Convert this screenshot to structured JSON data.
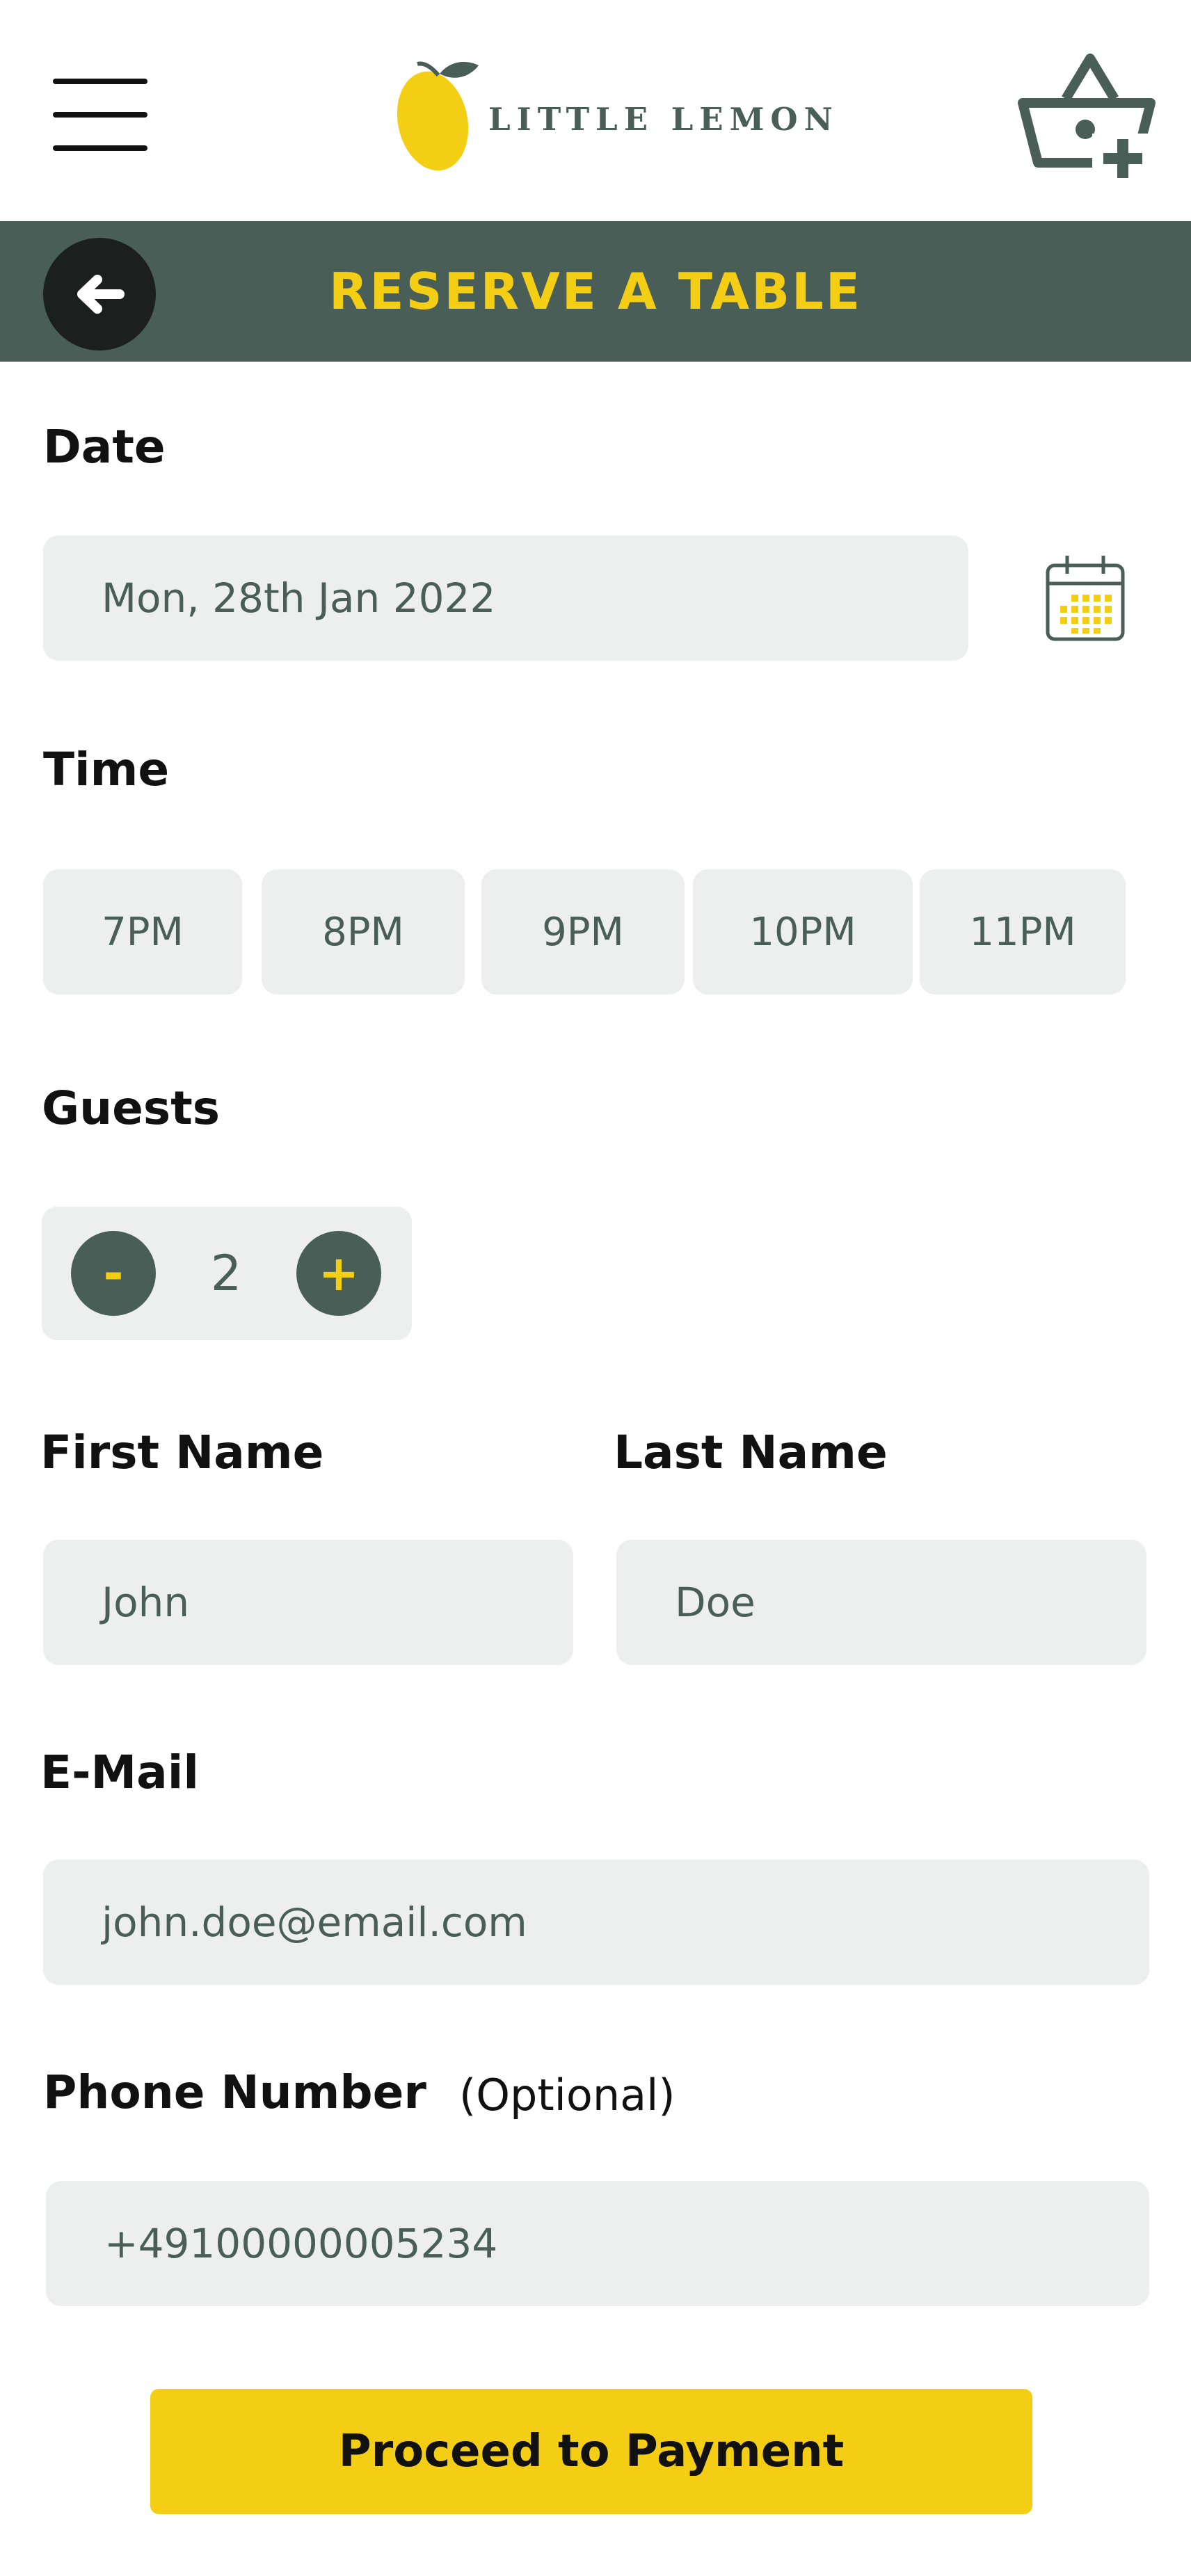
{
  "header": {
    "brand": "LITTLE LEMON",
    "menu_icon": "hamburger-menu-icon",
    "cart_icon": "basket-add-icon"
  },
  "banner": {
    "title": "RESERVE A TABLE",
    "back_icon": "arrow-left-icon"
  },
  "form": {
    "date": {
      "label": "Date",
      "value": "Mon, 28th Jan 2022",
      "icon": "calendar-icon"
    },
    "time": {
      "label": "Time",
      "options": [
        "7PM",
        "8PM",
        "9PM",
        "10PM",
        "11PM"
      ]
    },
    "guests": {
      "label": "Guests",
      "minus": "-",
      "value": "2",
      "plus": "+"
    },
    "first_name": {
      "label": "First Name",
      "value": "John"
    },
    "last_name": {
      "label": "Last Name",
      "value": "Doe"
    },
    "email": {
      "label": "E-Mail",
      "value": "john.doe@email.com"
    },
    "phone": {
      "label": "Phone Number",
      "optional": "(Optional)",
      "value": "+49100000005234"
    },
    "submit": "Proceed to Payment"
  },
  "colors": {
    "primary_green": "#495e57",
    "primary_yellow": "#f4ce14",
    "field_bg": "#edefee",
    "dark_circle": "#1b201e"
  }
}
